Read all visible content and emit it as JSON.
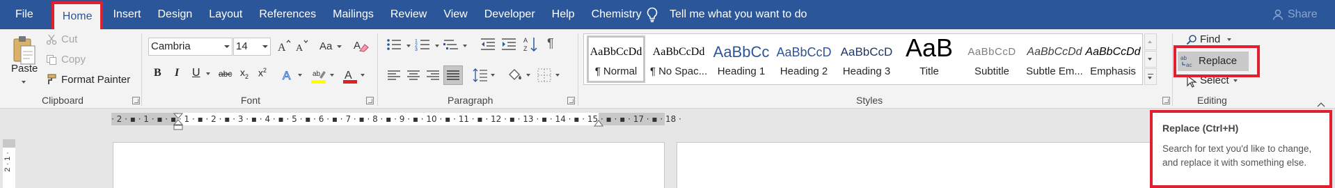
{
  "menubar": {
    "tabs": [
      "File",
      "Home",
      "Insert",
      "Design",
      "Layout",
      "References",
      "Mailings",
      "Review",
      "View",
      "Developer",
      "Help",
      "Chemistry"
    ],
    "active_tab": "Home",
    "tell_me": "Tell me what you want to do",
    "share": "Share"
  },
  "clipboard": {
    "paste": "Paste",
    "cut": "Cut",
    "copy": "Copy",
    "format_painter": "Format Painter",
    "label": "Clipboard"
  },
  "font": {
    "name": "Cambria",
    "size": "14",
    "label": "Font"
  },
  "paragraph": {
    "label": "Paragraph"
  },
  "styles": {
    "label": "Styles",
    "items": [
      {
        "sample": "AaBbCcDd",
        "name": "¶ Normal"
      },
      {
        "sample": "AaBbCcDd",
        "name": "¶ No Spac..."
      },
      {
        "sample": "AaBbCc",
        "name": "Heading 1"
      },
      {
        "sample": "AaBbCcD",
        "name": "Heading 2"
      },
      {
        "sample": "AaBbCcD",
        "name": "Heading 3"
      },
      {
        "sample": "AaB",
        "name": "Title"
      },
      {
        "sample": "AaBbCcD",
        "name": "Subtitle"
      },
      {
        "sample": "AaBbCcDd",
        "name": "Subtle Em..."
      },
      {
        "sample": "AaBbCcDd",
        "name": "Emphasis"
      }
    ]
  },
  "editing": {
    "find": "Find",
    "replace": "Replace",
    "select": "Select",
    "label": "Editing"
  },
  "ruler": {
    "numbers": "· 2 · ▪ · 1 · ▪ · ▪ · 1 · ▪ · 2 · ▪ · 3 · ▪ · 4 · ▪ · 5 · ▪ · 6 · ▪ · 7 · ▪ · 8 · ▪ · 9 · ▪ · 10 · ▪ · 11 · ▪ · 12 · ▪ · 13 · ▪ · 14 · ▪ · 15 · ▪ · ▪ · 17 · ▪ · 18 ·",
    "vertical": "2 · 1 ·"
  },
  "tooltip": {
    "title": "Replace (Ctrl+H)",
    "description": "Search for text you'd like to change, and replace it with something else."
  },
  "colors": {
    "accent": "#2b579a",
    "highlight_box": "#e0202e",
    "text_highlight": "#ffff00",
    "font_color": "#e02020"
  }
}
